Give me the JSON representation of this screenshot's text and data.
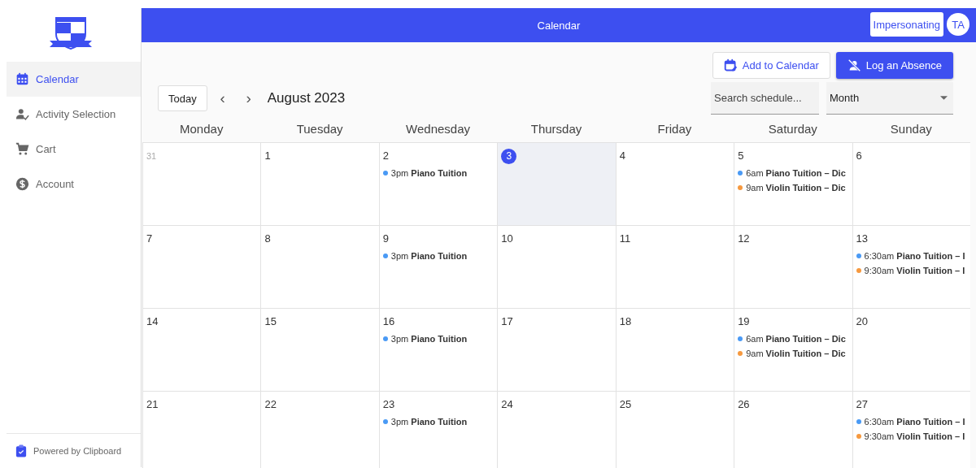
{
  "sidebar": {
    "items": [
      {
        "label": "Calendar",
        "selected": true
      },
      {
        "label": "Activity Selection",
        "selected": false
      },
      {
        "label": "Cart",
        "selected": false
      },
      {
        "label": "Account",
        "selected": false
      }
    ],
    "footer": "Powered by Clipboard"
  },
  "header": {
    "title": "Calendar",
    "impersonating": "Impersonating",
    "avatar": "TA"
  },
  "actions": {
    "add": "Add to Calendar",
    "absence": "Log an Absence"
  },
  "toolbar": {
    "today": "Today",
    "prev": "‹",
    "next": "›",
    "month": "August 2023",
    "search_placeholder": "Search schedule...",
    "view": "Month"
  },
  "weekdays": [
    "Monday",
    "Tuesday",
    "Wednesday",
    "Thursday",
    "Friday",
    "Saturday",
    "Sunday"
  ],
  "weeks": [
    [
      {
        "day": "31",
        "kind": "outside"
      },
      {
        "day": "1",
        "kind": "normal"
      },
      {
        "day": "2",
        "kind": "normal",
        "events": [
          {
            "time": "3pm",
            "title": "Piano Tuition",
            "color": "#4a9af5"
          }
        ]
      },
      {
        "day": "3",
        "kind": "today"
      },
      {
        "day": "4",
        "kind": "normal"
      },
      {
        "day": "5",
        "kind": "normal",
        "events": [
          {
            "time": "6am",
            "title": "Piano Tuition – Dic",
            "color": "#4a9af5"
          },
          {
            "time": "9am",
            "title": "Violin Tuition – Dic",
            "color": "#f6993f"
          }
        ]
      },
      {
        "day": "6",
        "kind": "normal"
      }
    ],
    [
      {
        "day": "7",
        "kind": "normal"
      },
      {
        "day": "8",
        "kind": "normal"
      },
      {
        "day": "9",
        "kind": "normal",
        "events": [
          {
            "time": "3pm",
            "title": "Piano Tuition",
            "color": "#4a9af5"
          }
        ]
      },
      {
        "day": "10",
        "kind": "normal"
      },
      {
        "day": "11",
        "kind": "normal"
      },
      {
        "day": "12",
        "kind": "normal"
      },
      {
        "day": "13",
        "kind": "normal",
        "events": [
          {
            "time": "6:30am",
            "title": "Piano Tuition – I",
            "color": "#4a9af5"
          },
          {
            "time": "9:30am",
            "title": "Violin Tuition – I",
            "color": "#f6993f"
          }
        ]
      }
    ],
    [
      {
        "day": "14",
        "kind": "normal"
      },
      {
        "day": "15",
        "kind": "normal"
      },
      {
        "day": "16",
        "kind": "normal",
        "events": [
          {
            "time": "3pm",
            "title": "Piano Tuition",
            "color": "#4a9af5"
          }
        ]
      },
      {
        "day": "17",
        "kind": "normal"
      },
      {
        "day": "18",
        "kind": "normal"
      },
      {
        "day": "19",
        "kind": "normal",
        "events": [
          {
            "time": "6am",
            "title": "Piano Tuition – Dic",
            "color": "#4a9af5"
          },
          {
            "time": "9am",
            "title": "Violin Tuition – Dic",
            "color": "#f6993f"
          }
        ]
      },
      {
        "day": "20",
        "kind": "normal"
      }
    ],
    [
      {
        "day": "21",
        "kind": "normal"
      },
      {
        "day": "22",
        "kind": "normal"
      },
      {
        "day": "23",
        "kind": "normal",
        "events": [
          {
            "time": "3pm",
            "title": "Piano Tuition",
            "color": "#4a9af5"
          }
        ]
      },
      {
        "day": "24",
        "kind": "normal"
      },
      {
        "day": "25",
        "kind": "normal"
      },
      {
        "day": "26",
        "kind": "normal"
      },
      {
        "day": "27",
        "kind": "normal",
        "events": [
          {
            "time": "6:30am",
            "title": "Piano Tuition – I",
            "color": "#4a9af5"
          },
          {
            "time": "9:30am",
            "title": "Violin Tuition – I",
            "color": "#f6993f"
          }
        ]
      }
    ]
  ]
}
